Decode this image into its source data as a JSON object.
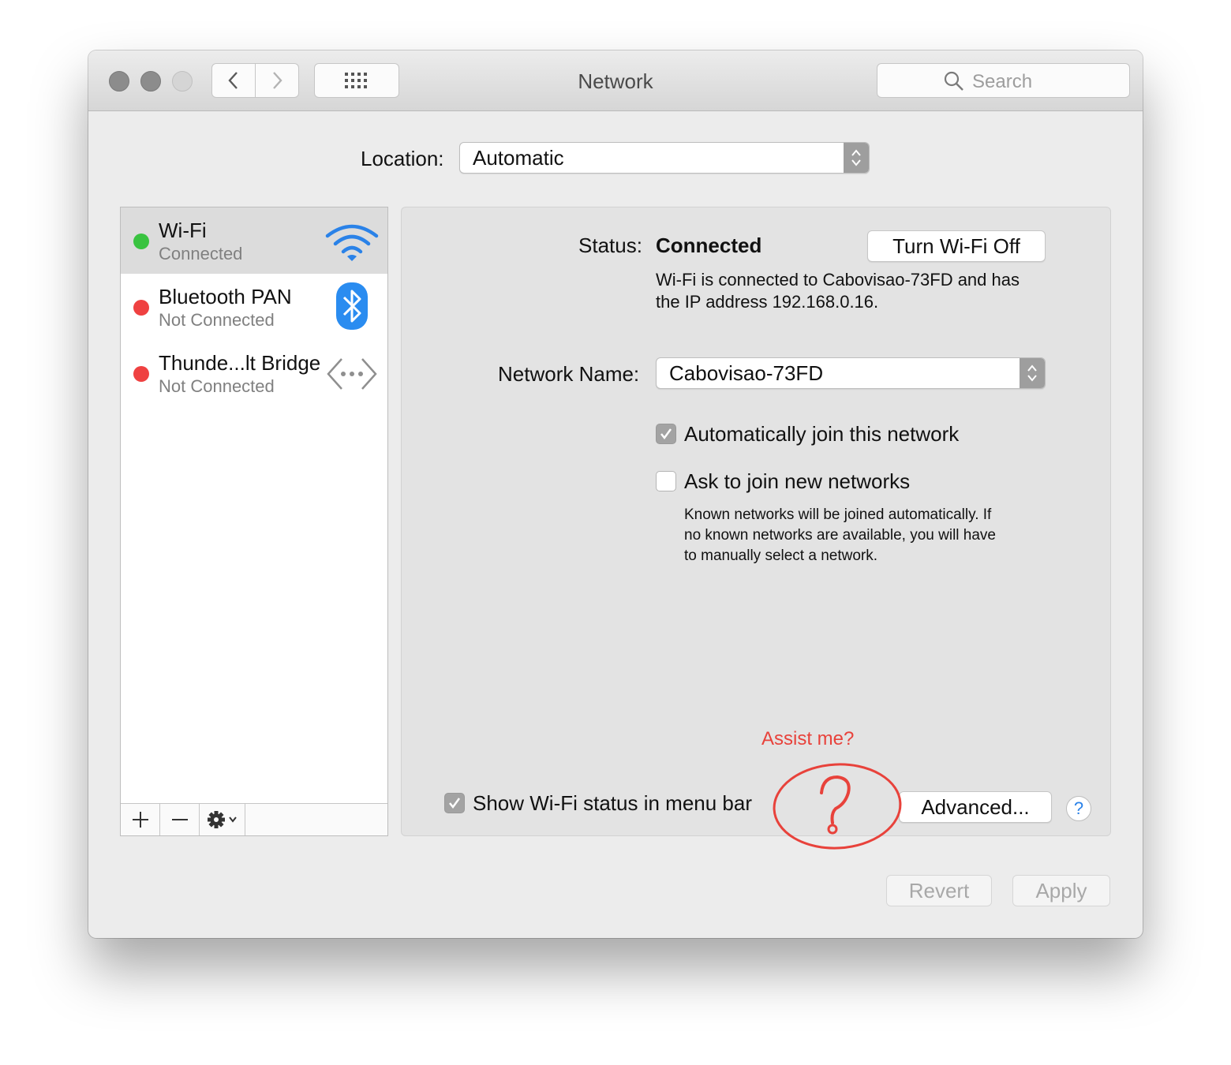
{
  "window": {
    "title": "Network",
    "search_placeholder": "Search"
  },
  "location": {
    "label": "Location:",
    "value": "Automatic"
  },
  "services": [
    {
      "name": "Wi-Fi",
      "status": "Connected",
      "icon": "wifi-icon",
      "status_color": "#39c340"
    },
    {
      "name": "Bluetooth PAN",
      "status": "Not Connected",
      "icon": "bluetooth-icon",
      "status_color": "#ef4141"
    },
    {
      "name": "Thunde...lt Bridge",
      "status": "Not Connected",
      "icon": "thunderbolt-bridge-icon",
      "status_color": "#ef4141"
    }
  ],
  "detail": {
    "status_label": "Status:",
    "status_value": "Connected",
    "turn_off_button": "Turn Wi-Fi Off",
    "description_line1": "Wi-Fi is connected to Cabovisao-73FD and has",
    "description_line2": "the IP address 192.168.0.16.",
    "network_name_label": "Network Name:",
    "network_name_value": "Cabovisao-73FD",
    "auto_join_label": "Automatically join this network",
    "auto_join_checked": true,
    "ask_join_label": "Ask to join new networks",
    "ask_join_checked": false,
    "ask_help_line1": "Known networks will be joined automatically. If",
    "ask_help_line2": "no known networks are available, you will have",
    "ask_help_line3": "to manually select a network.",
    "show_status_label": "Show Wi-Fi status in menu bar",
    "show_status_checked": true,
    "assist_label": "Assist me?",
    "advanced_button": "Advanced...",
    "help_button": "?"
  },
  "footer": {
    "revert_button": "Revert",
    "apply_button": "Apply"
  },
  "colors": {
    "accent_red": "#e8423b",
    "help_blue": "#2a82e8"
  }
}
